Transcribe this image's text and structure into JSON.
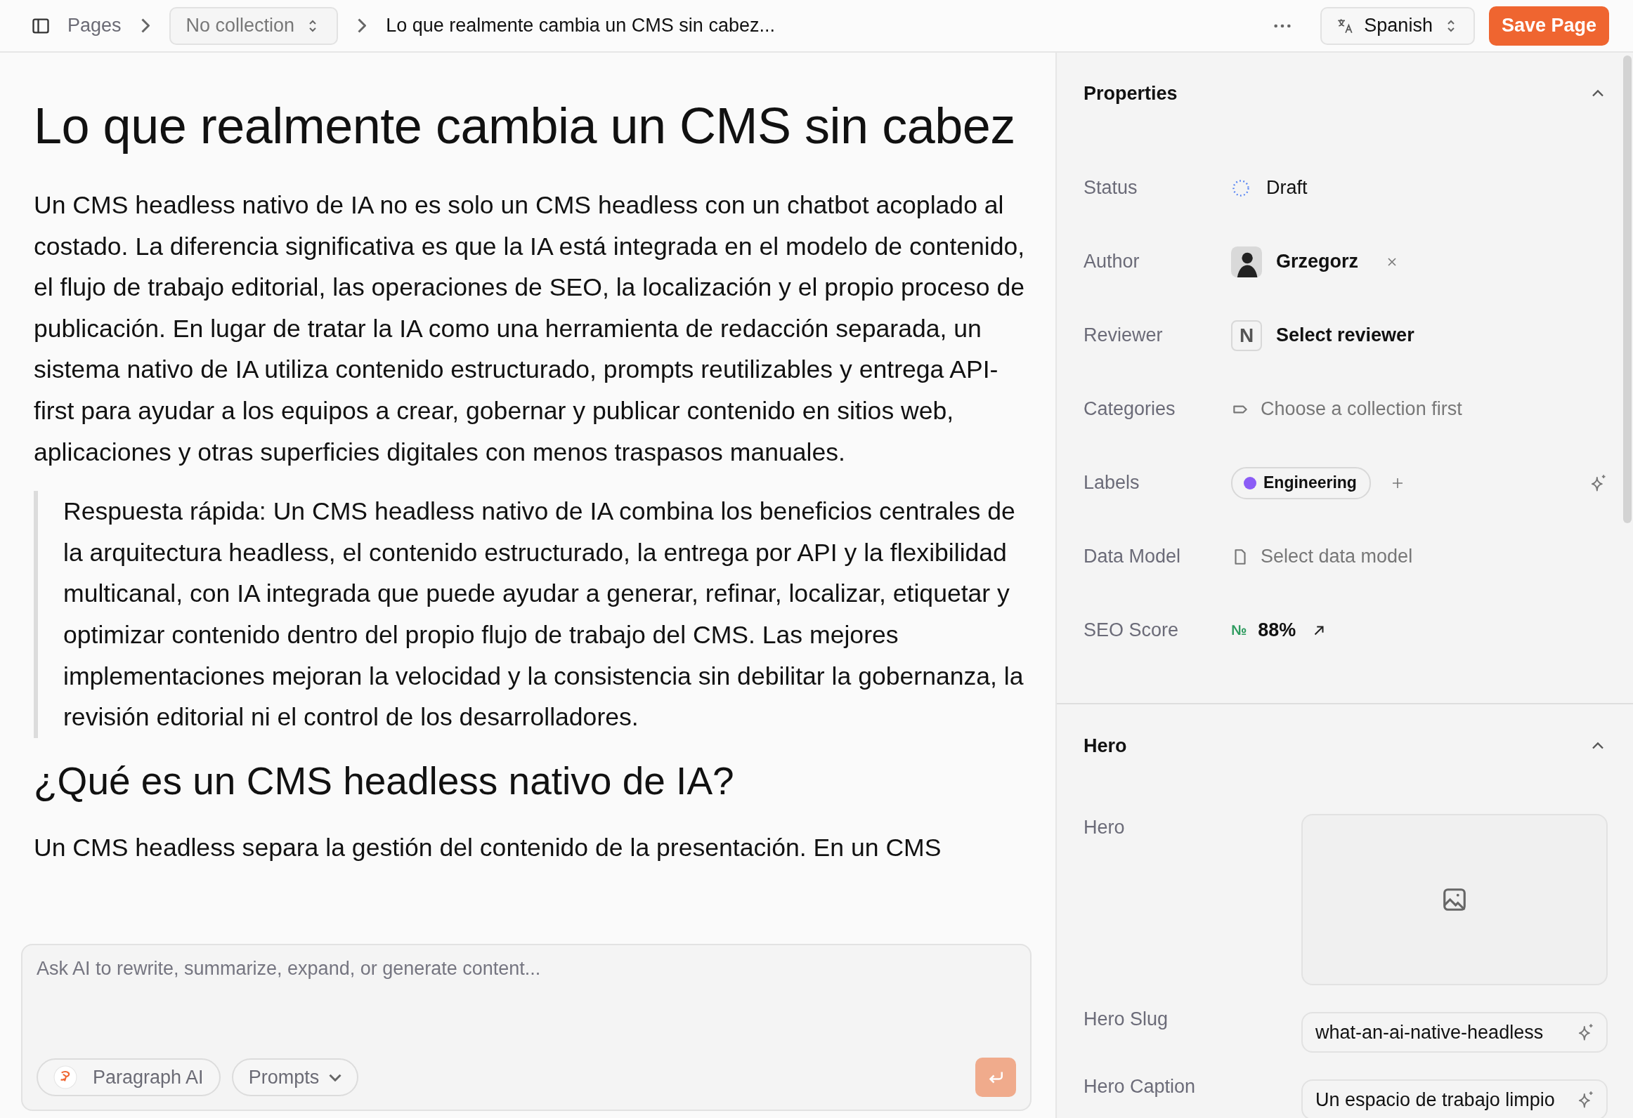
{
  "toolbar": {
    "section": "Pages",
    "collection": "No collection",
    "page_title": "Lo que realmente cambia un CMS sin cabez...",
    "language": "Spanish",
    "save_button": "Save Page"
  },
  "editor": {
    "title": "Lo que realmente cambia un CMS sin cabez",
    "blocks": [
      {
        "kind": "paragraph",
        "text": "Un CMS headless nativo de IA no es solo un CMS headless con un chatbot acoplado al costado. La diferencia significativa es que la IA está integrada en el modelo de contenido, el flujo de trabajo editorial, las operaciones de SEO, la localización y el propio proceso de publicación. En lugar de tratar la IA como una herramienta de redacción separada, un sistema nativo de IA utiliza contenido estructurado, prompts reutilizables y entrega API-first para ayudar a los equipos a crear, gobernar y publicar contenido en sitios web, aplicaciones y otras superficies digitales con menos traspasos manuales."
      },
      {
        "kind": "quote",
        "text": "Respuesta rápida: Un CMS headless nativo de IA combina los beneficios centrales de la arquitectura headless, el contenido estructurado, la entrega por API y la flexibilidad multicanal, con IA integrada que puede ayudar a generar, refinar, localizar, etiquetar y optimizar contenido dentro del propio flujo de trabajo del CMS. Las mejores implementaciones mejoran la velocidad y la consistencia sin debilitar la gobernanza, la revisión editorial ni el control de los desarrolladores."
      },
      {
        "kind": "heading",
        "text": "¿Qué es un CMS headless nativo de IA?"
      },
      {
        "kind": "paragraph",
        "text": "Un CMS headless separa la gestión del contenido de la presentación. En un CMS"
      }
    ]
  },
  "ai_box": {
    "placeholder": "Ask AI to rewrite, summarize, expand, or generate content...",
    "model": "Paragraph AI",
    "prompts": "Prompts"
  },
  "properties": {
    "title": "Properties",
    "expanded": true,
    "rows": [
      {
        "kind": "status",
        "label": "Status",
        "value": "Draft"
      },
      {
        "kind": "person",
        "label": "Author",
        "value": "Grzegorz"
      },
      {
        "kind": "reviewer",
        "label": "Reviewer",
        "initial": "N",
        "value": "Select reviewer"
      },
      {
        "kind": "category",
        "label": "Categories",
        "placeholder": "Choose a collection first"
      },
      {
        "kind": "labels",
        "label": "Labels",
        "tags": [
          {
            "name": "Engineering",
            "color": "#8b5cf6"
          }
        ]
      },
      {
        "kind": "model",
        "label": "Data Model",
        "placeholder": "Select data model"
      },
      {
        "kind": "score",
        "label": "SEO Score",
        "prefix": "№",
        "value": "88%"
      }
    ]
  },
  "hero": {
    "title": "Hero",
    "expanded": true,
    "fields": [
      {
        "kind": "image",
        "label": "Hero"
      },
      {
        "kind": "text",
        "label": "Hero Slug",
        "value": "what-an-ai-native-headless"
      },
      {
        "kind": "text",
        "label": "Hero Caption",
        "value": "Un espacio de trabajo limpio"
      }
    ]
  }
}
